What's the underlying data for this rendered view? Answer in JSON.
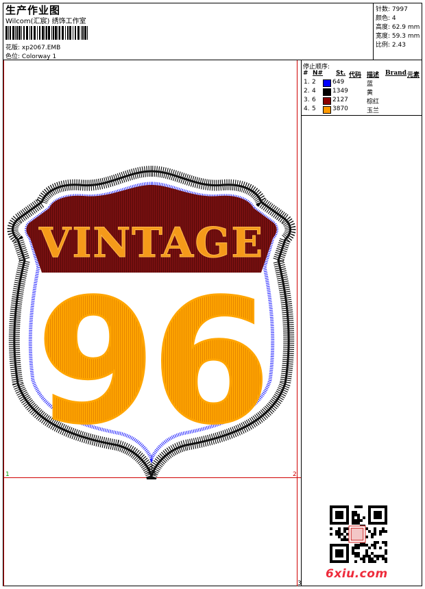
{
  "header": {
    "title": "生产作业图",
    "studio": "Wilcom(汇宸) 绣饰工作室",
    "design_label": "花版:",
    "design_value": "xp2067.EMB",
    "colorway_label": "色位:",
    "colorway_value": "Colorway 1"
  },
  "specs": [
    {
      "label": "针数:",
      "value": "7997"
    },
    {
      "label": "颜色:",
      "value": "4"
    },
    {
      "label": "高度:",
      "value": "62.9 mm"
    },
    {
      "label": "宽度:",
      "value": "59.3 mm"
    },
    {
      "label": "比例:",
      "value": "2.43"
    }
  ],
  "sequence": {
    "title": "停止顺序:",
    "columns": [
      "#",
      "N#",
      "St.",
      "代码",
      "描述",
      "Brand",
      "元素"
    ],
    "rows": [
      {
        "idx": "1.",
        "n": "2",
        "color": "#0000ff",
        "st": "649",
        "desc": "蓝"
      },
      {
        "idx": "2.",
        "n": "4",
        "color": "#000000",
        "st": "1349",
        "desc": "黄"
      },
      {
        "idx": "3.",
        "n": "6",
        "color": "#8b0000",
        "st": "2127",
        "desc": "棕红"
      },
      {
        "idx": "4.",
        "n": "5",
        "color": "#ff9900",
        "st": "3870",
        "desc": "玉兰"
      }
    ]
  },
  "design": {
    "banner_text": "VINTAGE",
    "number_text": "96",
    "colors": {
      "black": "#111111",
      "blue": "#1a1aff",
      "maroon": "#7a1010",
      "orange": "#ffa500",
      "banner_text": "#f59a1a"
    }
  },
  "markers": {
    "left": "1",
    "right": "2",
    "bottom": "3"
  },
  "watermark": "6xiu.com"
}
